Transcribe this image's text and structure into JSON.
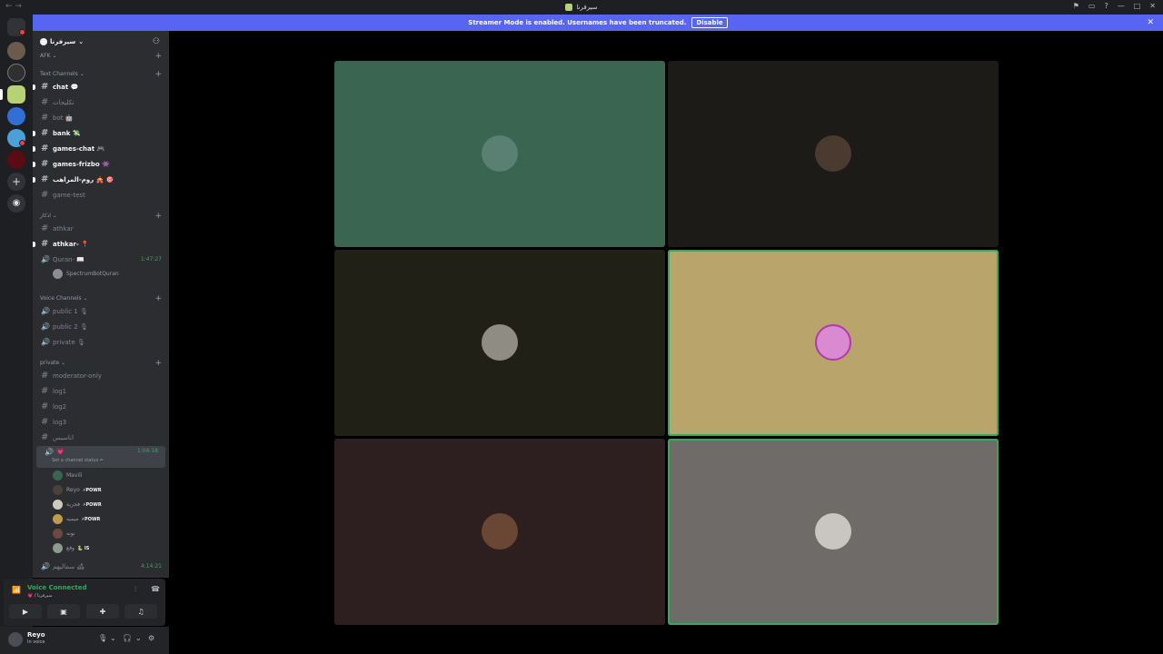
{
  "window": {
    "title": "سيرفرنا"
  },
  "banner": {
    "text": "Streamer Mode is enabled. Usernames have been truncated.",
    "button": "Disable"
  },
  "server": {
    "name": "سيرفرنا"
  },
  "channels": {
    "afk": "AFK",
    "text_category": "Text Channels",
    "chat": "chat 💬",
    "taxes": "تكليجات",
    "bot": "bot 🤖",
    "bank": "bank 💸",
    "games_chat": "games-chat 🎮",
    "games_frizbo": "games-frizbo 👾",
    "wars": "روم-المراهب 🎪 🎯",
    "game_test": "game-test",
    "athkar_category": "اذكار",
    "athkar": "athkar",
    "athkar2": "athkar- 📍",
    "quran": "Quran- 📖",
    "quran_timer": "1:47:27",
    "quran_bot": "SpectrumBotQuran",
    "voice_category": "Voice Channels",
    "public1": "public 1 🎙",
    "public2": "public 2 🎙",
    "private_v": "private 🎙",
    "private_category": "private",
    "mod": "moderator-only",
    "log1": "log1",
    "log2": "log2",
    "log3": "log3",
    "anas": "اناسيس",
    "active_voice": "💗",
    "active_timer": "1:04:18",
    "status_hint": "Set a channel status ✏",
    "users": [
      "Mavili",
      "Reyo",
      "فجرية",
      "ميميه",
      "نونه",
      "وقع"
    ],
    "powr": "⚡POWR",
    "vs": "🐍 IS",
    "last_voice": "سماليهم 🛋",
    "last_timer": "4:14:21"
  },
  "voice": {
    "connected": "Voice Connected",
    "sub": "💗 / سيرفرنا"
  },
  "user": {
    "name": "Reyo",
    "status": "In voice"
  },
  "colors": {
    "tile1": "#3a6551",
    "tile2": "#1c1b17",
    "tile3": "#202017",
    "tile4": "#b9a46c",
    "tile5": "#2d1f1f",
    "tile6": "#6f6b69"
  }
}
